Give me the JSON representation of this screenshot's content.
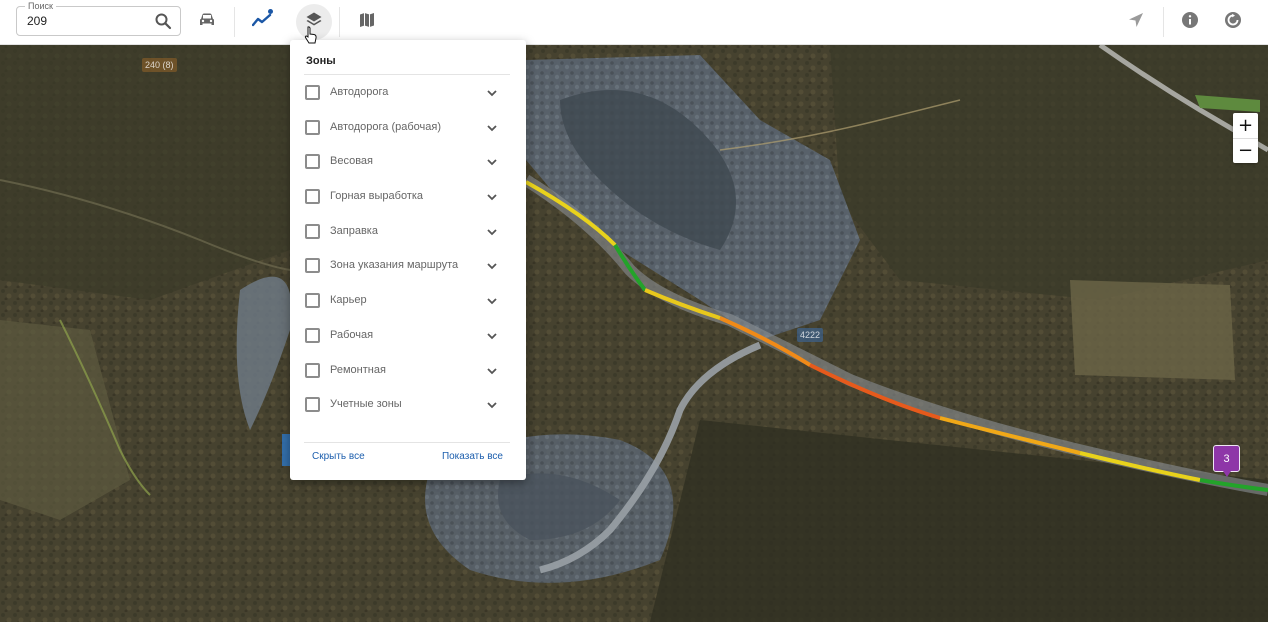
{
  "search": {
    "legend": "Поиск",
    "value": "209"
  },
  "toolbar": {
    "tools": [
      "car-icon",
      "route-icon",
      "layers-icon",
      "map-icon"
    ],
    "right_tools": [
      "location-arrow-icon",
      "info-icon",
      "refresh-icon"
    ],
    "accent_color": "#1b57a6"
  },
  "zoom": {
    "in": "+",
    "out": "−"
  },
  "map": {
    "labels": [
      "240 (8)",
      "4222"
    ],
    "vehicle_number": "3",
    "vehicle_color": "#8e36a8"
  },
  "layers_panel": {
    "title": "Зоны",
    "items": [
      {
        "label": "Автодорога"
      },
      {
        "label": "Автодорога (рабочая)"
      },
      {
        "label": "Весовая"
      },
      {
        "label": "Горная выработка"
      },
      {
        "label": "Заправка"
      },
      {
        "label": "Зона указания маршрута"
      },
      {
        "label": "Карьер"
      },
      {
        "label": "Рабочая"
      },
      {
        "label": "Ремонтная"
      },
      {
        "label": "Учетные зоны"
      }
    ],
    "hide_all": "Скрыть все",
    "show_all": "Показать все"
  }
}
